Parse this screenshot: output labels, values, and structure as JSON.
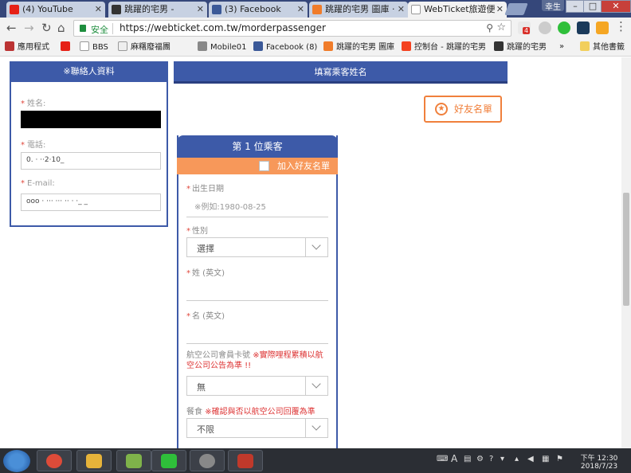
{
  "browser": {
    "tabs": [
      {
        "label": "(4) YouTube",
        "icon": "youtube-icon",
        "color": "#e62117"
      },
      {
        "label": "跳躍的宅男 -",
        "icon": "site-icon",
        "color": "#333333"
      },
      {
        "label": "(3) Facebook",
        "icon": "facebook-icon",
        "color": "#3b5998"
      },
      {
        "label": "跳躍的宅男 圖庫 ·",
        "icon": "gallery-icon",
        "color": "#f07c2a"
      },
      {
        "label": "WebTicket旅遊便",
        "icon": "page-icon",
        "color": "#999999",
        "active": true
      }
    ],
    "window_user": "幸生",
    "window_controls": {
      "minimize": "–",
      "maximize": "□",
      "close": "✕"
    },
    "security_label": "安全",
    "url": "https://webticket.com.tw/morderpassenger",
    "extension_badge": "4",
    "bookmarks": [
      {
        "label": "應用程式",
        "icon": "apps-icon"
      },
      {
        "label": "",
        "icon": "youtube-icon"
      },
      {
        "label": "BBS",
        "icon": "bbs-icon"
      },
      {
        "label": "麻糬廢福團",
        "icon": "page-icon"
      },
      {
        "label": "Mobile01",
        "icon": "mobile01-icon"
      },
      {
        "label": "Facebook (8)",
        "icon": "facebook-icon"
      },
      {
        "label": "跳躍的宅男 圖庫",
        "icon": "gallery-icon"
      },
      {
        "label": "控制台 - 跳躍的宅男",
        "icon": "joomla-icon"
      },
      {
        "label": "跳躍的宅男",
        "icon": "site-icon"
      },
      {
        "label": "»",
        "icon": ""
      },
      {
        "label": "其他書籤",
        "icon": "folder-icon"
      }
    ]
  },
  "contact": {
    "title": "※聯絡人資料",
    "name_label": "姓名:",
    "phone_label": "電話:",
    "phone_value": "0.  ·  ··2·10_",
    "email_label": "E-mail:",
    "email_value": "ooo  ·  ··· ··· ··  ·  ·_ _"
  },
  "passenger": {
    "section_title": "填寫乘客姓名",
    "friend_button": "好友名單",
    "card_title": "第 1 位乘客",
    "add_friend": "加入好友名單",
    "birth_label": "出生日期",
    "birth_placeholder": "※例如:1980-08-25",
    "gender_label": "性別",
    "gender_value": "選擇",
    "surname_label": "姓 (英文)",
    "given_label": "名 (英文)",
    "member_label": "航空公司會員卡號",
    "member_note": "※實際哩程累積以航空公司公告為準 !!",
    "member_value": "無",
    "meal_label": "餐食",
    "meal_note": "※確認與否以航空公司回覆為準",
    "meal_value": "不限"
  },
  "taskbar": {
    "apps": [
      {
        "name": "chrome",
        "icon": "chrome-icon",
        "color": "#dd4b39"
      },
      {
        "name": "explorer",
        "icon": "folder-icon",
        "color": "#e6b33a"
      },
      {
        "name": "image-viewer",
        "icon": "image-icon",
        "color": "#7fb24a"
      },
      {
        "name": "line",
        "icon": "line-icon",
        "color": "#2fbf3a"
      },
      {
        "name": "recorder",
        "icon": "record-icon",
        "color": "#888888"
      },
      {
        "name": "camera",
        "icon": "camera-icon",
        "color": "#c0392b"
      }
    ],
    "tray_text": "A",
    "time": "下午 12:30",
    "date": "2018/7/23"
  }
}
